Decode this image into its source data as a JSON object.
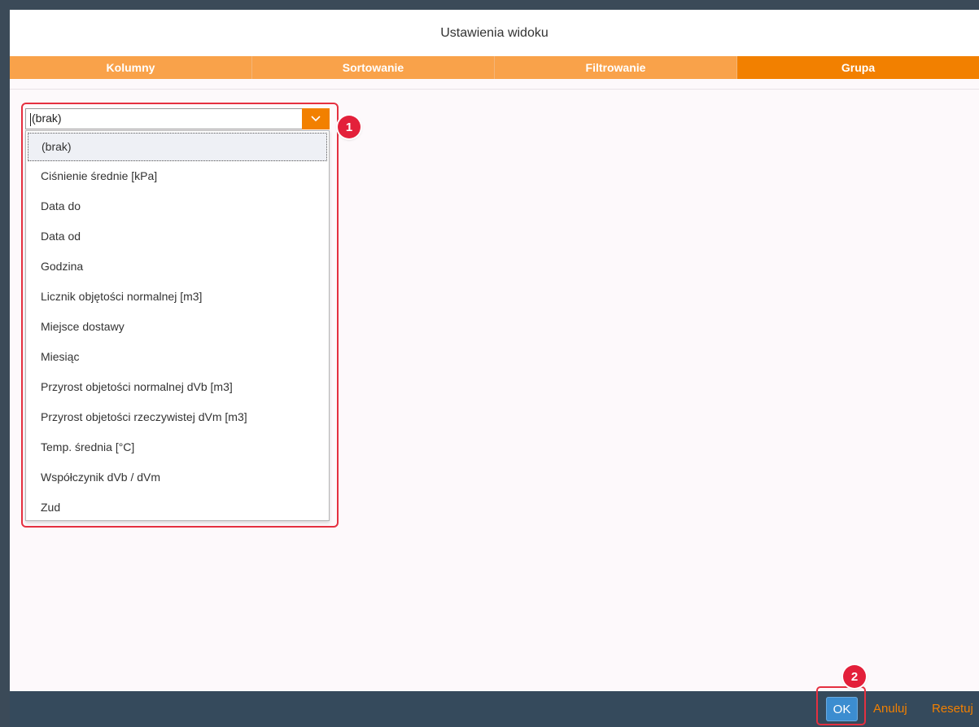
{
  "dialog": {
    "title": "Ustawienia widoku",
    "tabs": [
      {
        "label": "Kolumny",
        "active": false
      },
      {
        "label": "Sortowanie",
        "active": false
      },
      {
        "label": "Filtrowanie",
        "active": false
      },
      {
        "label": "Grupa",
        "active": true
      }
    ]
  },
  "group_select": {
    "value": "(brak)",
    "options": [
      "(brak)",
      "Ciśnienie średnie [kPa]",
      "Data do",
      "Data od",
      "Godzina",
      "Licznik objętości normalnej [m3]",
      "Miejsce dostawy",
      "Miesiąc",
      "Przyrost objetości normalnej dVb [m3]",
      "Przyrost objetości rzeczywistej dVm [m3]",
      "Temp. średnia [°C]",
      "Współczynik dVb / dVm",
      "Zud"
    ]
  },
  "annotations": {
    "badge1": "1",
    "badge2": "2"
  },
  "footer": {
    "ok_label": "OK",
    "cancel_label": "Anuluj",
    "reset_label": "Resetuj"
  },
  "colors": {
    "accent": "#f28000",
    "tab_inactive": "#f9a24a",
    "footer_bg": "#354a5c",
    "ok_bg": "#3c8dd0",
    "annotation_red": "#e3203a"
  }
}
